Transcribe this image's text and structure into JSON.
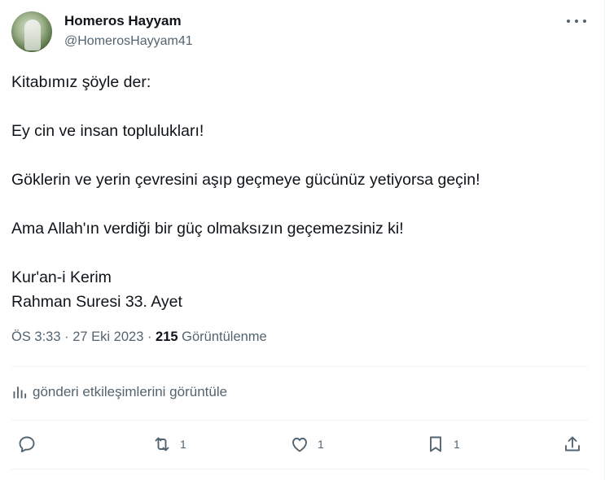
{
  "author": {
    "display_name": "Homeros Hayyam",
    "handle": "@HomerosHayyam41"
  },
  "body": {
    "lines": [
      "Kitabımız şöyle der:",
      "Ey cin ve insan toplulukları!",
      "Göklerin ve yerin çevresini aşıp geçmeye gücünüz yetiyorsa geçin!",
      "Ama Allah'ın verdiği bir güç olmaksızın geçemezsiniz ki!",
      "Kur'an-i Kerim",
      "Rahman Suresi 33. Ayet"
    ]
  },
  "meta": {
    "time": "ÖS 3:33",
    "separator": "·",
    "date": "27 Eki 2023",
    "views_count": "215",
    "views_label": "Görüntülenme"
  },
  "engagement_link": "gönderi etkileşimlerini görüntüle",
  "actions": {
    "reply": {
      "icon": "reply-icon",
      "count": ""
    },
    "repost": {
      "icon": "repost-icon",
      "count": "1"
    },
    "like": {
      "icon": "heart-icon",
      "count": "1"
    },
    "bookmark": {
      "icon": "bookmark-icon",
      "count": "1"
    },
    "share": {
      "icon": "share-icon",
      "count": ""
    }
  },
  "colors": {
    "text_primary": "#0f1419",
    "text_secondary": "#536471",
    "divider": "#eff3f4"
  }
}
